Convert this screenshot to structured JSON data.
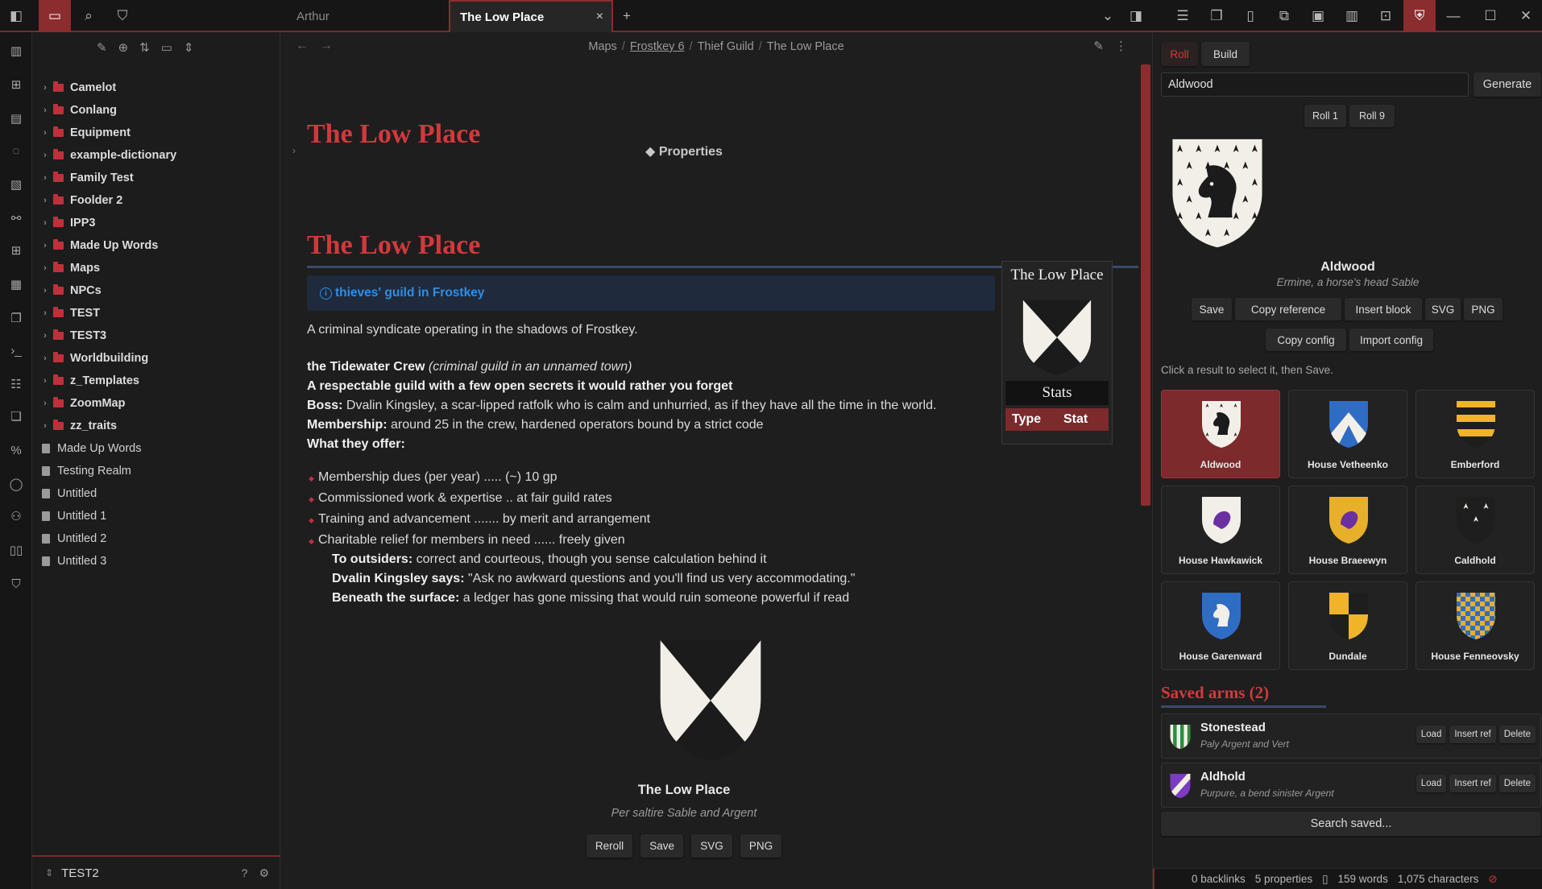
{
  "tabs": {
    "inactive": "Arthur",
    "active": "The Low Place",
    "close": "×",
    "new": "+"
  },
  "icons": {
    "sidebar_toggle": "sidebar-toggle-icon",
    "folder": "folder-icon",
    "search": "search-icon",
    "bookmark": "bookmark-icon"
  },
  "explorer": {
    "folders": [
      "Camelot",
      "Conlang",
      "Equipment",
      "example-dictionary",
      "Family Test",
      "Foolder 2",
      "IPP3",
      "Made Up Words",
      "Maps",
      "NPCs",
      "TEST",
      "TEST3",
      "Worldbuilding",
      "z_Templates",
      "ZoomMap",
      "zz_traits"
    ],
    "files": [
      "Made Up Words",
      "Testing Realm",
      "Untitled",
      "Untitled 1",
      "Untitled 2",
      "Untitled 3"
    ],
    "vault_name": "TEST2"
  },
  "editor": {
    "breadcrumb": [
      "Maps",
      "Frostkey 6",
      "Thief Guild",
      "The Low Place"
    ],
    "title": "The Low Place",
    "properties_label": "Properties",
    "heading": "The Low Place",
    "callout": "thieves' guild in Frostkey",
    "intro": "A criminal syndicate operating in the shadows of Frostkey.",
    "crew_name": "the Tidewater Crew",
    "crew_note": "(criminal guild in an unnamed town)",
    "tagline": "A respectable guild with a few open secrets it would rather you forget",
    "boss_label": "Boss:",
    "boss_text": "Dvalin Kingsley, a scar-lipped ratfolk who is calm and unhurried, as if they have all the time in the world.",
    "membership_label": "Membership:",
    "membership_text": "around 25 in the crew, hardened operators bound by a strict code",
    "offer_label": "What they offer:",
    "offers": [
      "Membership dues (per year) ..... (~) 10 gp",
      "Commissioned work & expertise .. at fair guild rates",
      "Training and advancement ....... by merit and arrangement",
      "Charitable relief for members in need ...... freely given"
    ],
    "outsiders_label": "To outsiders:",
    "outsiders_text": "correct and courteous, though you sense calculation behind it",
    "says_label": "Dvalin Kingsley says:",
    "says_text": "\"Ask no awkward questions and you'll find us very accommodating.\"",
    "beneath_label": "Beneath the surface:",
    "beneath_text": "a ledger has gone missing that would ruin someone powerful if read",
    "coa_name": "The Low Place",
    "coa_blazon": "Per saltire Sable and Argent",
    "coa_buttons": [
      "Reroll",
      "Save",
      "SVG",
      "PNG"
    ],
    "infobox": {
      "title": "The Low Place",
      "stats": "Stats",
      "col1": "Type",
      "col2": "Stat"
    }
  },
  "panel": {
    "tab_roll": "Roll",
    "tab_build": "Build",
    "seed": "Aldwood",
    "generate": "Generate",
    "roll1": "Roll 1",
    "roll9": "Roll 9",
    "selected_name": "Aldwood",
    "selected_blazon": "Ermine, a horse's head Sable",
    "actions": [
      "Save",
      "Copy reference",
      "Insert block",
      "SVG",
      "PNG"
    ],
    "actions2": [
      "Copy config",
      "Import config"
    ],
    "hint": "Click a result to select it, then Save.",
    "results": [
      "Aldwood",
      "House Vetheenko",
      "Emberford",
      "House Hawkawick",
      "House Braeewyn",
      "Caldhold",
      "House Garenward",
      "Dundale",
      "House Fenneovsky"
    ],
    "saved_heading": "Saved arms (2)",
    "saved": [
      {
        "name": "Stonestead",
        "blazon": "Paly Argent and Vert"
      },
      {
        "name": "Aldhold",
        "blazon": "Purpure, a bend sinister Argent"
      }
    ],
    "saved_actions": [
      "Load",
      "Insert ref",
      "Delete"
    ],
    "search_saved": "Search saved..."
  },
  "status": {
    "backlinks": "0 backlinks",
    "properties": "5 properties",
    "words": "159 words",
    "chars": "1,075 characters"
  },
  "colors": {
    "accent": "#8b2d2f",
    "heading": "#d2393c",
    "link": "#2d8ee8"
  }
}
